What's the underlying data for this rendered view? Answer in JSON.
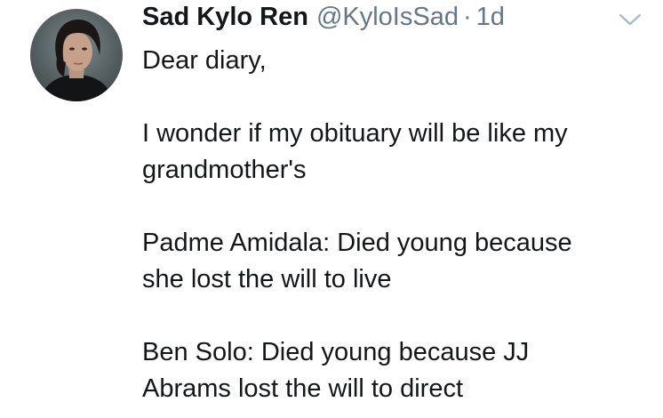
{
  "tweet": {
    "display_name": "Sad Kylo Ren",
    "handle": "@KyloIsSad",
    "separator": "·",
    "time": "1d",
    "paragraphs": [
      "Dear diary,",
      "I wonder if my obituary will be like my\ngrandmother's",
      "Padme Amidala: Died young because\nshe lost the will to live",
      "Ben Solo: Died young because JJ\nAbrams lost the will to direct"
    ]
  },
  "icons": {
    "avatar": "profile-photo",
    "menu": "chevron-down-icon"
  },
  "colors": {
    "text": "#14171a",
    "secondary": "#657786",
    "chevron": "#aab8c2",
    "background": "#ffffff"
  }
}
